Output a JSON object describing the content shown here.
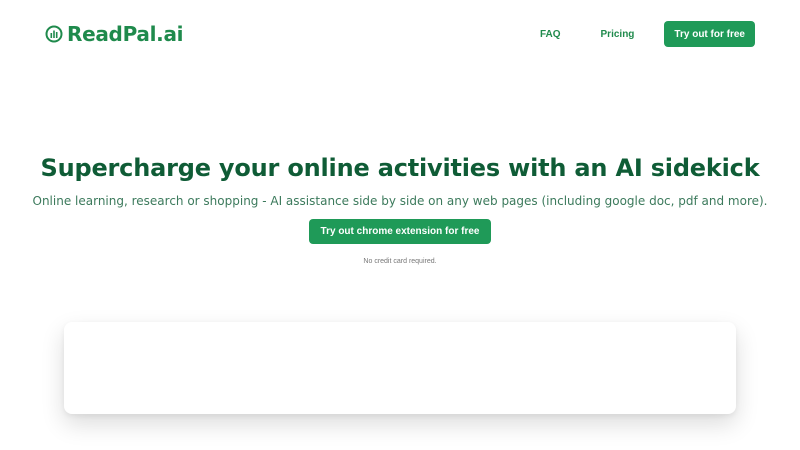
{
  "header": {
    "logo": {
      "text": "ReadPal.ai",
      "icon": "readpal-logo-icon",
      "brand_color": "#1f8a4c"
    },
    "nav": {
      "faq_label": "FAQ",
      "pricing_label": "Pricing",
      "cta_label": "Try out for free"
    }
  },
  "hero": {
    "title": "Supercharge your online activities with an AI sidekick",
    "subtitle": "Online learning, research or shopping - AI assistance side by side on any web pages (including google doc, pdf and more).",
    "cta_label": "Try out chrome extension for free",
    "note": "No credit card required."
  },
  "colors": {
    "accent": "#1f9a58",
    "title": "#0f5c36",
    "subtitle": "#3c7a5c"
  }
}
